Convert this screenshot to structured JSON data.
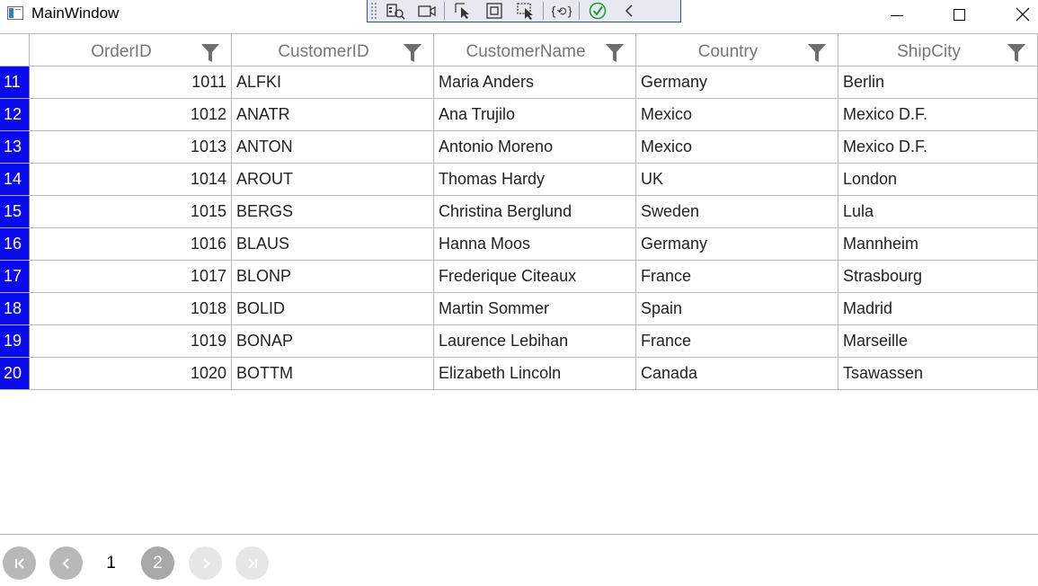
{
  "window": {
    "title": "MainWindow",
    "controls": {
      "minimize": "minimize-icon",
      "maximize": "maximize-icon",
      "close": "close-icon"
    }
  },
  "debug_toolbar": {
    "items": [
      "live-visual-tree-icon",
      "record-icon",
      "select-element-icon",
      "display-layout-adorners-icon",
      "track-focus-icon",
      "hot-reload-icon",
      "hot-reload-status-icon",
      "collapse-icon"
    ]
  },
  "grid": {
    "columns": [
      {
        "header": "OrderID",
        "align": "right"
      },
      {
        "header": "CustomerID",
        "align": "left"
      },
      {
        "header": "CustomerName",
        "align": "left"
      },
      {
        "header": "Country",
        "align": "left"
      },
      {
        "header": "ShipCity",
        "align": "left"
      }
    ],
    "rows": [
      {
        "row_header": "11",
        "cells": [
          "1011",
          "ALFKI",
          "Maria Anders",
          "Germany",
          "Berlin"
        ]
      },
      {
        "row_header": "12",
        "cells": [
          "1012",
          "ANATR",
          "Ana Trujilo",
          "Mexico",
          "Mexico D.F."
        ]
      },
      {
        "row_header": "13",
        "cells": [
          "1013",
          "ANTON",
          "Antonio Moreno",
          "Mexico",
          "Mexico D.F."
        ]
      },
      {
        "row_header": "14",
        "cells": [
          "1014",
          "AROUT",
          "Thomas Hardy",
          "UK",
          "London"
        ]
      },
      {
        "row_header": "15",
        "cells": [
          "1015",
          "BERGS",
          "Christina Berglund",
          "Sweden",
          "Lula"
        ]
      },
      {
        "row_header": "16",
        "cells": [
          "1016",
          "BLAUS",
          "Hanna Moos",
          "Germany",
          "Mannheim"
        ]
      },
      {
        "row_header": "17",
        "cells": [
          "1017",
          "BLONP",
          "Frederique Citeaux",
          "France",
          "Strasbourg"
        ]
      },
      {
        "row_header": "18",
        "cells": [
          "1018",
          "BOLID",
          "Martin Sommer",
          "Spain",
          "Madrid"
        ]
      },
      {
        "row_header": "19",
        "cells": [
          "1019",
          "BONAP",
          "Laurence Lebihan",
          "France",
          "Marseille"
        ]
      },
      {
        "row_header": "20",
        "cells": [
          "1020",
          "BOTTM",
          "Elizabeth Lincoln",
          "Canada",
          "Tsawassen"
        ]
      }
    ],
    "colors": {
      "row_header_bg": "#0a0af0",
      "row_header_fg": "#ffffff",
      "header_fg": "#767676",
      "filter_icon": "#6e6e6e"
    }
  },
  "pager": {
    "first": "first-page-icon",
    "previous": "previous-page-icon",
    "pages": [
      {
        "label": "1",
        "selected": false
      },
      {
        "label": "2",
        "selected": true
      }
    ],
    "next": "next-page-icon",
    "last": "last-page-icon",
    "colors": {
      "enabled_bg": "#b8b8b8",
      "disabled_bg": "#e6e6e6",
      "selected_bg": "#a8a8a8"
    }
  }
}
